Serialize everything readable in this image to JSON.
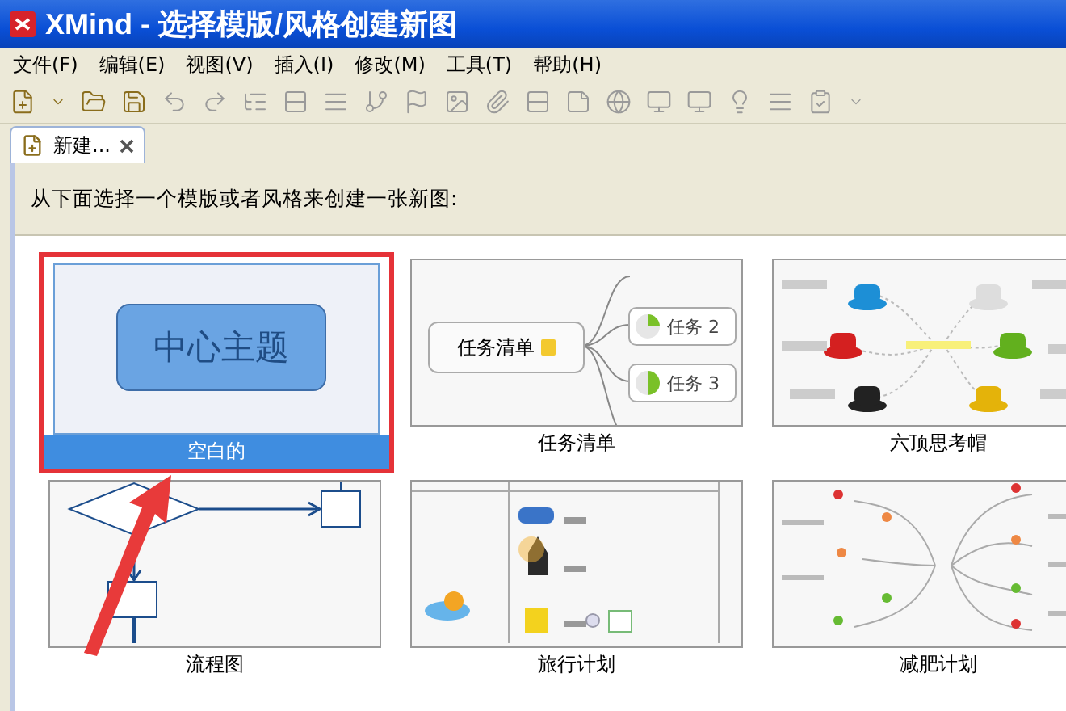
{
  "window": {
    "title": "XMind - 选择模版/风格创建新图"
  },
  "menu": [
    "文件(F)",
    "编辑(E)",
    "视图(V)",
    "插入(I)",
    "修改(M)",
    "工具(T)",
    "帮助(H)"
  ],
  "tabs": [
    {
      "label": "新建...",
      "selected": true
    }
  ],
  "instruction": "从下面选择一个模版或者风格来创建一张新图:",
  "templates": [
    {
      "kind": "blank",
      "label": "空白的",
      "selected": true,
      "preview_text": "中心主题"
    },
    {
      "kind": "tasks",
      "label": "任务清单",
      "selected": false,
      "preview_text": "任务清单",
      "tasks": [
        "任务 2",
        "任务 3"
      ]
    },
    {
      "kind": "hats",
      "label": "六顶思考帽",
      "selected": false
    },
    {
      "kind": "flow",
      "label": "流程图",
      "selected": false
    },
    {
      "kind": "travel",
      "label": "旅行计划",
      "selected": false
    },
    {
      "kind": "diet",
      "label": "减肥计划",
      "selected": false
    }
  ]
}
